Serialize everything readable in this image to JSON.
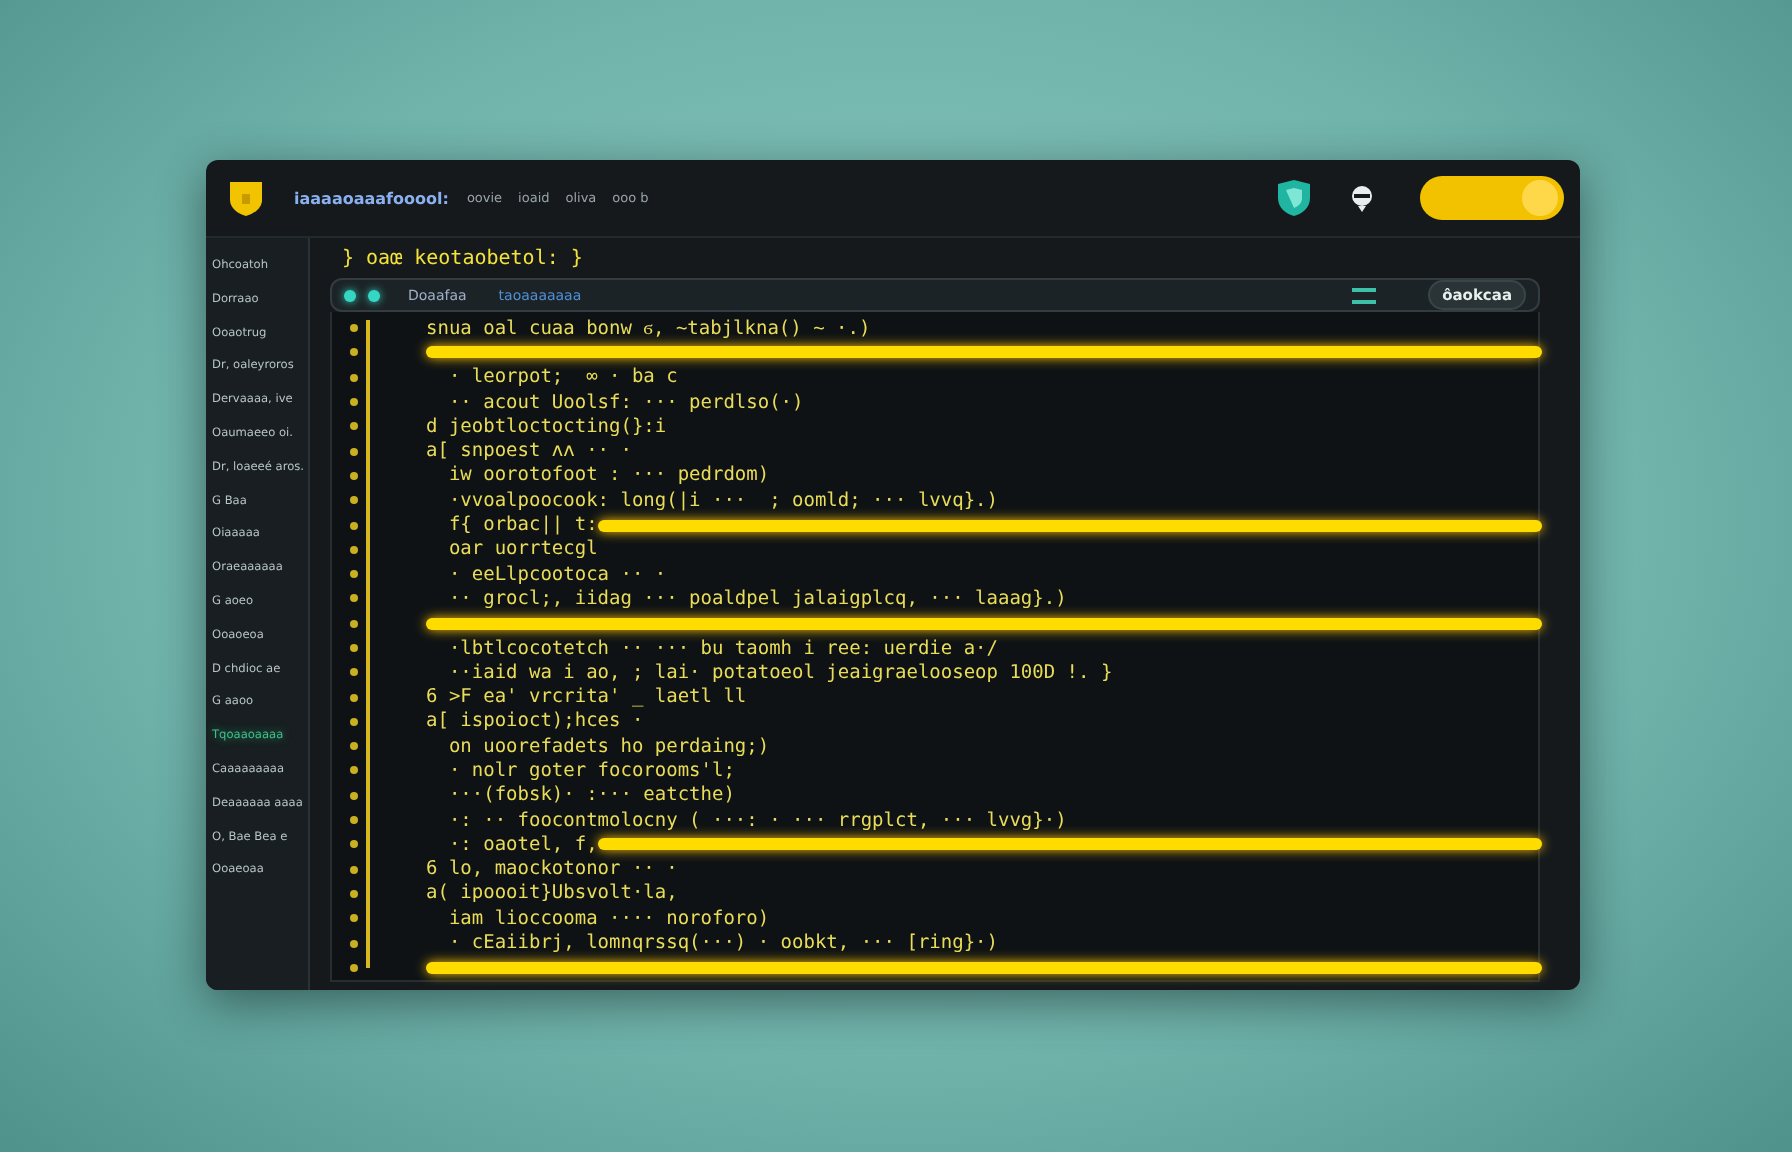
{
  "window": {
    "title": "iaaaaoaaafooool:",
    "menu": [
      "oovie",
      "ioaid",
      "oliva",
      "ooo b"
    ],
    "toggle": {
      "on": true
    }
  },
  "sidebar": {
    "items": [
      {
        "label": "Ohcoatoh",
        "selected": false
      },
      {
        "label": "Dorraao",
        "selected": false
      },
      {
        "label": "Ooaotrug",
        "selected": false
      },
      {
        "label": "Dr, oaleyroros",
        "selected": false
      },
      {
        "label": "Dervaaaa, ive",
        "selected": false
      },
      {
        "label": "Oaumaeeo oi.",
        "selected": false
      },
      {
        "label": "Dr, loaeeé aros.",
        "selected": false
      },
      {
        "label": "G  Baa",
        "selected": false
      },
      {
        "label": "Oiaaaaa",
        "selected": false
      },
      {
        "label": "Oraeaaaaaa",
        "selected": false
      },
      {
        "label": "G  aoeo",
        "selected": false
      },
      {
        "label": "Ooaoeoa",
        "selected": false
      },
      {
        "label": "D chdioc ae",
        "selected": false
      },
      {
        "label": "G  aaoo",
        "selected": false
      },
      {
        "label": "Tqoaaoaaaa",
        "selected": true
      },
      {
        "label": "Caaaaaaaaa",
        "selected": false
      },
      {
        "label": "Deaaaaaa aaaa",
        "selected": false
      },
      {
        "label": "O, Bae  Bea e",
        "selected": false
      },
      {
        "label": "Ooaeoaa",
        "selected": false
      }
    ]
  },
  "editor": {
    "breadcrumb": "} oaœ keotaobetol: }",
    "tabs": [
      {
        "label": "Doaafaa",
        "selected": false
      },
      {
        "label": "taoaaaaaaa",
        "selected": true
      }
    ],
    "action_button": "ôaokcaa",
    "lines": [
      {
        "kind": "code",
        "text": "snua oal cuaa bonw ϭ, ~tabjlkna() ~ ·.)"
      },
      {
        "kind": "highlight"
      },
      {
        "kind": "code",
        "text": "  · leorpot;  ∞ · ba c"
      },
      {
        "kind": "code",
        "text": "  ·· acout Uoolsf: ··· perdlso(·)"
      },
      {
        "kind": "code",
        "text": "d jeobtloctocting(}:i"
      },
      {
        "kind": "code",
        "text": "a[ snpoest ʌʌ ·· ·"
      },
      {
        "kind": "code",
        "text": "  iw oorotofoot : ··· pedrdom)"
      },
      {
        "kind": "code",
        "text": "  ·vvoalpoocook: long(|i ···  ; oomld; ··· lvvq}.)"
      },
      {
        "kind": "highlight",
        "text": "  f{ orbac|| t:"
      },
      {
        "kind": "code",
        "text": "  oar uorrtecgl"
      },
      {
        "kind": "code",
        "text": "  · eeLlpcootoca ·· ·"
      },
      {
        "kind": "code",
        "text": "  ·· grocl;, iidag ··· poaldpel jalaigplcq, ··· laaag}.)"
      },
      {
        "kind": "highlight"
      },
      {
        "kind": "code",
        "text": "  ·lbtlcocotetch ·· ··· bu taomh i ree: uerdie a·/"
      },
      {
        "kind": "code",
        "text": "  ··iaid wa i ao, ; lai· potatoeol jeaigraelooseop 100D !. }"
      },
      {
        "kind": "code",
        "text": "6 >F ea' vrcrita' _ laetl ll"
      },
      {
        "kind": "code",
        "text": "a[ ispoioct);hces ·"
      },
      {
        "kind": "code",
        "text": "  on uoorefadets ho perdaing;)"
      },
      {
        "kind": "code",
        "text": "  · nolr goter focorooms'l;"
      },
      {
        "kind": "code",
        "text": "  ···(fobsk)· :··· eatcthe)"
      },
      {
        "kind": "code",
        "text": "  ·: ·· foocontmolocny ( ···: · ··· rrgplct, ··· lvvg}·)"
      },
      {
        "kind": "highlight",
        "text": "  ·: oaotel, f,"
      },
      {
        "kind": "code",
        "text": "6 lo, maockotonor ·· ·"
      },
      {
        "kind": "code",
        "text": "a( ipoooit}Ubsvolt·la,"
      },
      {
        "kind": "code",
        "text": "  iam lioccooma ···· noroforo)"
      },
      {
        "kind": "code",
        "text": "  · cEaiibrj, lomnqrssq(···) · oobkt, ··· [ring}·)"
      },
      {
        "kind": "highlight"
      }
    ]
  }
}
